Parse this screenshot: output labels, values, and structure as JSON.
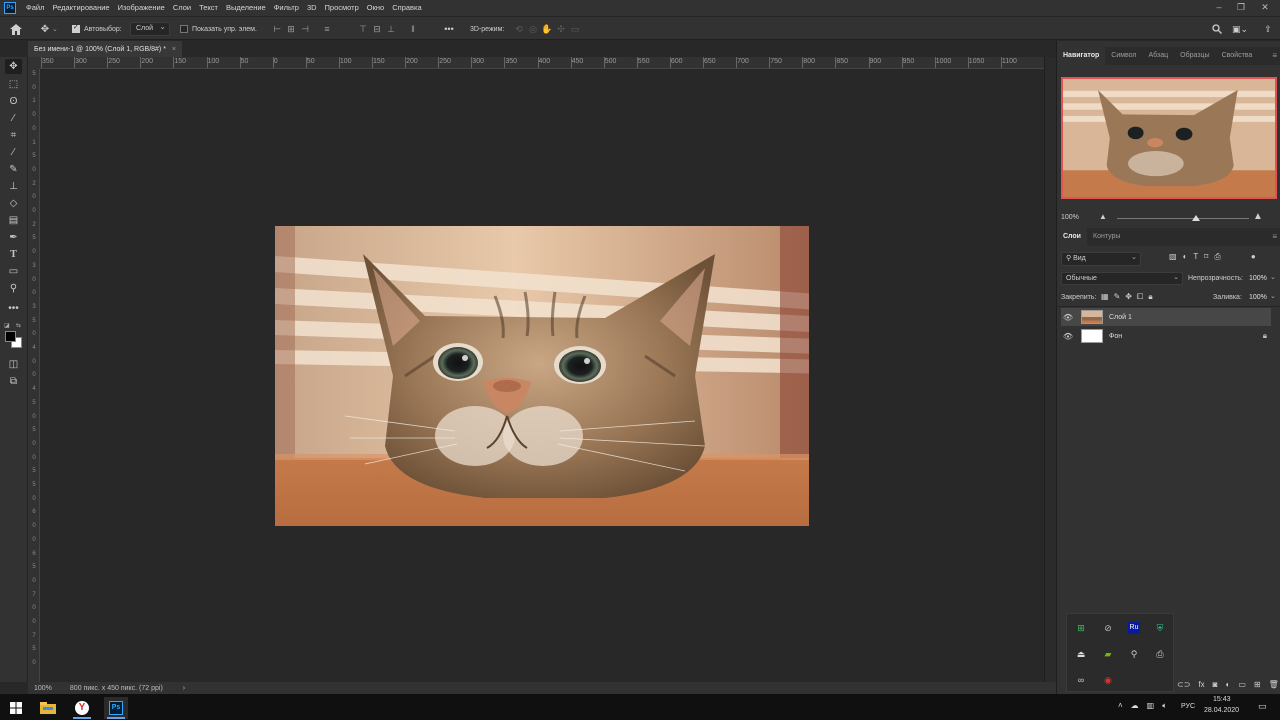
{
  "app": {
    "logo_text": "Ps"
  },
  "menu": [
    "Файл",
    "Редактирование",
    "Изображение",
    "Слои",
    "Текст",
    "Выделение",
    "Фильтр",
    "3D",
    "Просмотр",
    "Окно",
    "Справка"
  ],
  "options": {
    "autoselect_label": "Автовыбор:",
    "autoselect_checked": true,
    "autoselect_target": "Слой",
    "show_transform_label": "Показать упр. элем.",
    "show_transform_checked": false,
    "mode_3d_label": "3D-режим:"
  },
  "document": {
    "tab_title": "Без имени-1 @ 100% (Слой 1, RGB/8#) *",
    "close_glyph": "×"
  },
  "ruler": {
    "h_labels": [
      "350",
      "300",
      "250",
      "200",
      "150",
      "100",
      "50",
      "0",
      "50",
      "100",
      "150",
      "200",
      "250",
      "300",
      "350",
      "400",
      "450",
      "500",
      "550",
      "600",
      "650",
      "700",
      "750",
      "800",
      "850",
      "900",
      "950",
      "1000",
      "1050",
      "1100"
    ],
    "v_labels": [
      "5",
      "0",
      "1",
      "0",
      "0",
      "1",
      "5",
      "0",
      "2",
      "0",
      "0",
      "2",
      "5",
      "0",
      "3",
      "0",
      "0",
      "3",
      "5",
      "0",
      "4",
      "0",
      "0",
      "4",
      "5",
      "0",
      "5",
      "0",
      "0",
      "5",
      "5",
      "0",
      "6",
      "0",
      "0",
      "6",
      "5",
      "0",
      "7",
      "0",
      "0",
      "7",
      "5",
      "0"
    ]
  },
  "status": {
    "zoom": "100%",
    "doc_size": "800 пикс. x 450 пикс. (72 ppi)",
    "arrow": "›"
  },
  "navigator_panel": {
    "tabs": [
      "Навигатор",
      "Символ",
      "Абзац",
      "Образцы",
      "Свойства"
    ],
    "zoom": "100%",
    "zoom_fraction": 0.6
  },
  "layers_panel": {
    "tabs": [
      "Слои",
      "Контуры"
    ],
    "filter": "Вид",
    "blend_mode": "Обычные",
    "opacity_label": "Непрозрачность:",
    "opacity_value": "100%",
    "lock_label": "Закрепить:",
    "fill_label": "Заливка:",
    "fill_value": "100%",
    "layers": [
      {
        "name": "Слой 1",
        "visible": true,
        "selected": true
      },
      {
        "name": "Фон",
        "visible": true,
        "selected": false,
        "locked": true
      }
    ]
  },
  "taskbar": {
    "language": "РУС",
    "time": "15:43",
    "date": "28.04.2020",
    "tray_app_label": "Ru"
  },
  "colors": {
    "accent_blue": "#31a8ff",
    "nav_frame": "#e05454"
  }
}
